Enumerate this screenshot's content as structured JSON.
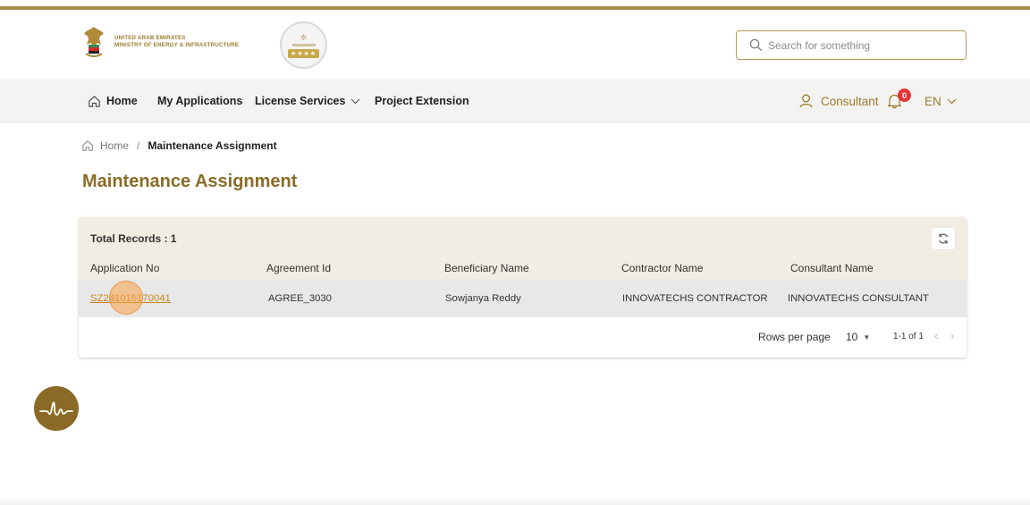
{
  "header": {
    "ministry_line1": "UNITED ARAB EMIRATES",
    "ministry_line2": "MINISTRY OF ENERGY & INFRASTRUCTURE",
    "search_placeholder": "Search for something"
  },
  "nav": {
    "home": "Home",
    "my_applications": "My Applications",
    "license_services": "License Services",
    "project_extension": "Project Extension",
    "user": "Consultant",
    "notification_count": "0",
    "language": "EN"
  },
  "breadcrumb": {
    "home": "Home",
    "separator": "/",
    "current": "Maintenance Assignment"
  },
  "page": {
    "title": "Maintenance Assignment"
  },
  "table": {
    "total_records": "Total Records : 1",
    "columns": [
      "Application No",
      "Agreement Id",
      "Beneficiary Name",
      "Contractor Name",
      "Consultant Name"
    ],
    "rows": [
      [
        "SZ241015170041",
        "AGREE_3030",
        "Sowjanya Reddy",
        "INNOVATECHS CONTRACTOR",
        "INNOVATECHS CONSULTANT"
      ]
    ],
    "pagination": {
      "rows_per_page_label": "Rows per page",
      "rows_per_page": "10",
      "range": "1-1 of 1"
    }
  },
  "colors": {
    "brand_gold": "#a48b45",
    "title_gold": "#8a6c26",
    "link_orange": "#c8821e",
    "badge_red": "#e5343a"
  }
}
